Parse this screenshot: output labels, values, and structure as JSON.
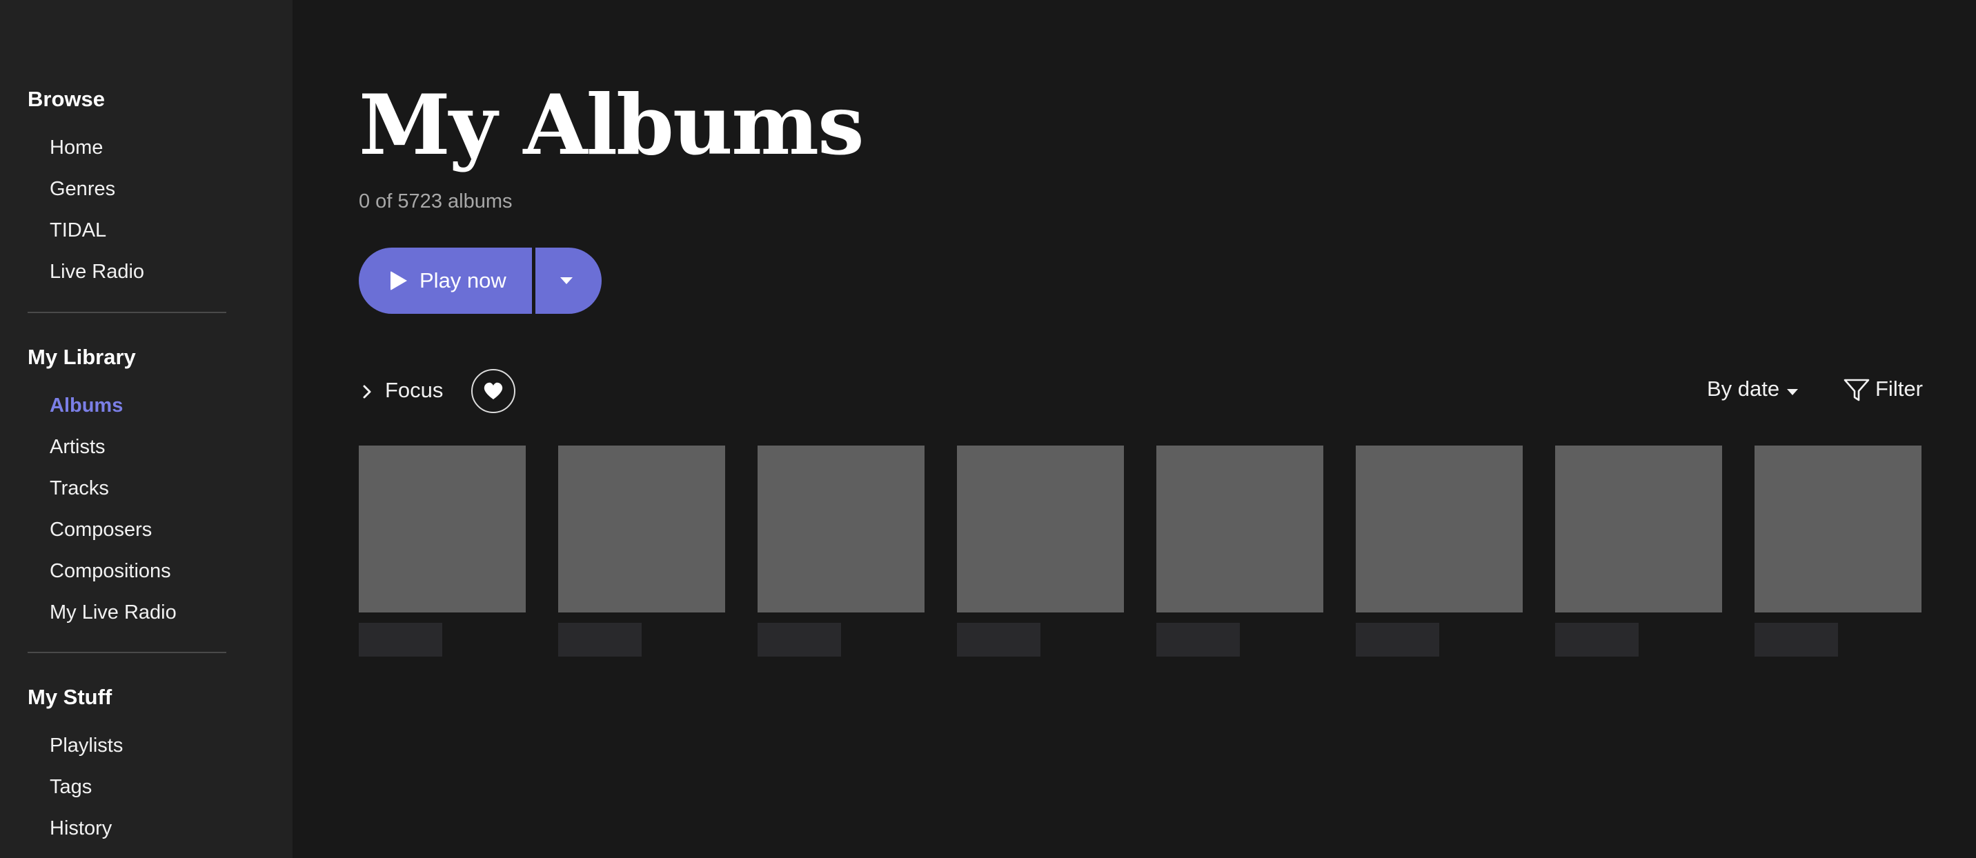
{
  "sidebar": {
    "browse": {
      "title": "Browse",
      "items": [
        {
          "label": "Home"
        },
        {
          "label": "Genres"
        },
        {
          "label": "TIDAL"
        },
        {
          "label": "Live Radio"
        }
      ]
    },
    "library": {
      "title": "My Library",
      "active": "Albums",
      "items": [
        {
          "label": "Albums"
        },
        {
          "label": "Artists"
        },
        {
          "label": "Tracks"
        },
        {
          "label": "Composers"
        },
        {
          "label": "Compositions"
        },
        {
          "label": "My Live Radio"
        }
      ]
    },
    "stuff": {
      "title": "My Stuff",
      "items": [
        {
          "label": "Playlists"
        },
        {
          "label": "Tags"
        },
        {
          "label": "History"
        }
      ]
    }
  },
  "main": {
    "title": "My Albums",
    "count_text": "0 of 5723 albums",
    "play_button": {
      "label": "Play now",
      "icon": "play-icon"
    },
    "play_dropdown": {
      "icon": "caret-down-icon"
    },
    "focus": {
      "label": "Focus",
      "icon": "chevron-right-icon"
    },
    "favorite": {
      "icon": "heart-icon"
    },
    "sort": {
      "label": "By date",
      "icon": "caret-down-icon"
    },
    "filter": {
      "label": "Filter",
      "icon": "filter-icon"
    },
    "albums_loading_placeholders": 8
  },
  "colors": {
    "accent": "#6b6fd6",
    "active_nav": "#7b7fe6",
    "background": "#181818",
    "sidebar": "#222222",
    "placeholder": "#5f5f5f"
  }
}
